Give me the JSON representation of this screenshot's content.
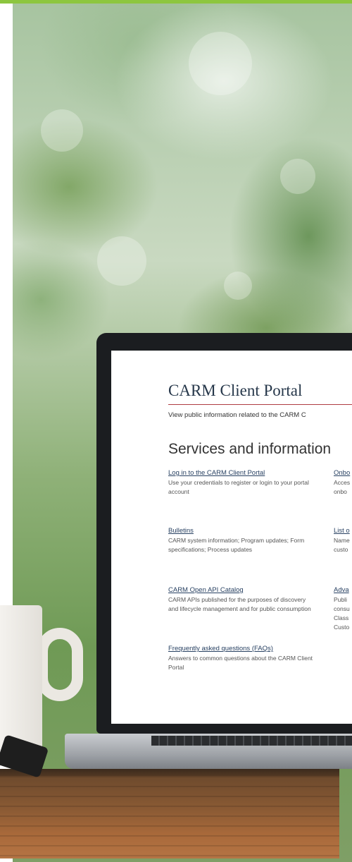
{
  "portal": {
    "title": "CARM Client Portal",
    "subtitle": "View public information related to the CARM C",
    "section_title": "Services and information"
  },
  "services_left": [
    {
      "link": "Log in to the CARM Client Portal",
      "desc": "Use your credentials to register or login to your portal account"
    },
    {
      "link": "Bulletins",
      "desc": "CARM system information; Program updates; Form specifications; Process updates"
    },
    {
      "link": "CARM Open API Catalog",
      "desc": "CARM APIs published for the purposes of discovery and lifecycle management and for public consumption"
    },
    {
      "link": "Frequently asked questions (FAQs)",
      "desc": "Answers to common questions about the CARM Client Portal"
    }
  ],
  "services_right": [
    {
      "link": "Onbo",
      "desc": "Acces\nonbo"
    },
    {
      "link": "List o",
      "desc": "Name\ncusto"
    },
    {
      "link": "Adva",
      "desc": "Publi\nconsu\nClass\nCusto"
    }
  ],
  "colors": {
    "accent_bar": "#8dc63f",
    "title_blue": "#26374a",
    "link_blue": "#284162",
    "rule_red": "#af3c43"
  }
}
